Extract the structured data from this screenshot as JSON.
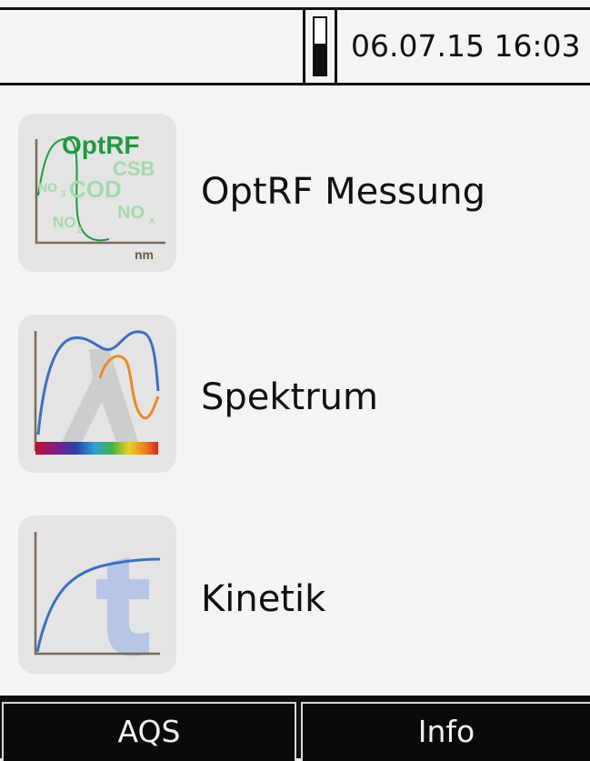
{
  "status_bar": {
    "datetime": "06.07.15 16:03",
    "battery_level": 0.55
  },
  "menu": [
    {
      "label": "OptRF Messung",
      "icon": "optrf-icon",
      "icon_text": {
        "title": "OptRF",
        "csb": "CSB",
        "no3": "NO",
        "no3_sub": "3",
        "cod": "COD",
        "nox": "NO",
        "nox_sub": "x",
        "no2": "NO",
        "no2_sub": "2",
        "axis_unit": "nm"
      }
    },
    {
      "label": "Spektrum",
      "icon": "spectrum-icon"
    },
    {
      "label": "Kinetik",
      "icon": "kinetics-icon"
    }
  ],
  "softkeys": {
    "left": "AQS",
    "right": "Info"
  },
  "colors": {
    "optrf_green": "#1f9a3f",
    "optrf_light_green": "#a6d9ad",
    "curve_blue": "#3d6fc2",
    "curve_orange": "#ea8a24",
    "lambda_grey": "#cdcdcd",
    "kinetik_t": "#b7c6e6"
  }
}
